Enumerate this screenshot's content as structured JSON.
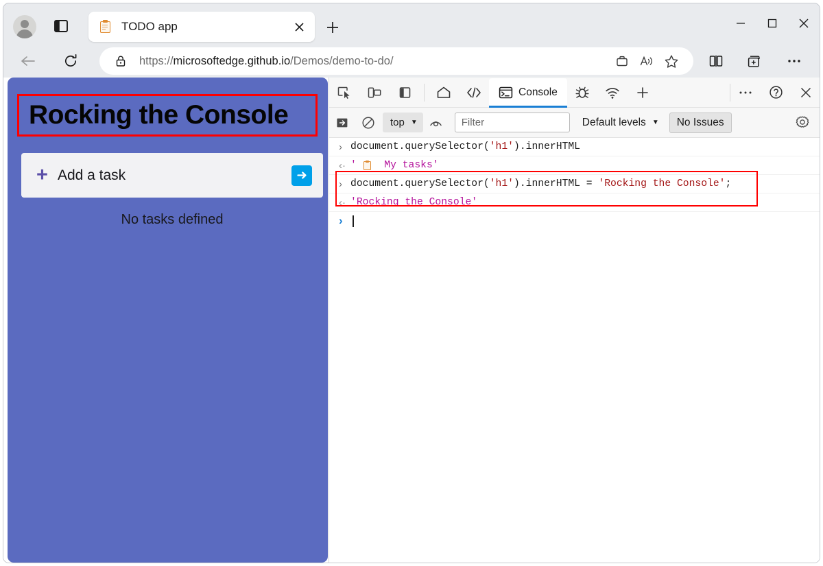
{
  "browser": {
    "tab": {
      "title": "TODO app",
      "favicon_icon": "clipboard-icon",
      "close_icon": "close-icon"
    },
    "new_tab_icon": "plus-icon",
    "profile_icon": "profile-avatar-icon",
    "tab_search_icon": "tab-search-icon",
    "nav": {
      "back_icon": "arrow-left-icon",
      "reload_icon": "reload-icon"
    },
    "omnibox": {
      "lock_icon": "lock-icon",
      "url_scheme": "https://",
      "url_host": "microsoftedge.github.io",
      "url_path": "/Demos/demo-to-do/",
      "url_full": "https://microsoftedge.github.io/Demos/demo-to-do/",
      "icons": [
        "shopping-bag-icon",
        "read-aloud-icon",
        "favorite-star-icon"
      ]
    },
    "chrome_icons": [
      "split-screen-icon",
      "collections-icon",
      "settings-more-icon"
    ],
    "window_controls": {
      "minimize": "minimize-icon",
      "maximize": "maximize-icon",
      "close": "close-icon"
    }
  },
  "page": {
    "heading": "Rocking the Console",
    "add_task_placeholder": "Add a task",
    "add_icon": "plus-icon",
    "submit_icon": "arrow-right-icon",
    "empty_message": "No tasks defined",
    "background_color": "#5b6bc0",
    "submit_button_color": "#00a0e9",
    "highlight_color": "#ff0000"
  },
  "devtools": {
    "toolbar_icons": [
      "inspect-element-icon",
      "device-emulation-icon",
      "dock-side-icon",
      "welcome-home-icon",
      "elements-icon"
    ],
    "active_tab": {
      "label": "Console",
      "icon": "console-icon"
    },
    "extra_tabs": [
      "debugger-icon",
      "network-icon",
      "add-panel-icon"
    ],
    "right_icons": [
      "more-tools-icon",
      "help-icon",
      "close-devtools-icon"
    ],
    "accent_color": "#1a7fd4",
    "console_toolbar": {
      "clear_console_icon": "clear-console-icon",
      "no-entry_icon": "no-entry-icon",
      "context_label": "top",
      "context_caret": "▼",
      "live_expression_icon": "eye-icon",
      "filter_placeholder": "Filter",
      "filter_value": "",
      "levels_label": "Default levels",
      "levels_caret": "▼",
      "issues_label": "No Issues",
      "settings_icon": "gear-icon"
    },
    "console_log": [
      {
        "type": "input",
        "arrow": "›",
        "tokens": [
          {
            "text": "document.querySelector(",
            "style": "plain"
          },
          {
            "text": "'h1'",
            "style": "str-input"
          },
          {
            "text": ").innerHTML",
            "style": "plain"
          }
        ],
        "highlighted": false
      },
      {
        "type": "result",
        "arrow": "‹·",
        "tokens": [
          {
            "text": "' ",
            "style": "str-result"
          },
          {
            "text": "[clipboard-icon]",
            "style": "favicon"
          },
          {
            "text": "  My tasks'",
            "style": "str-result"
          }
        ],
        "highlighted": false
      },
      {
        "type": "input",
        "arrow": "›",
        "tokens": [
          {
            "text": "document.querySelector(",
            "style": "plain"
          },
          {
            "text": "'h1'",
            "style": "str-input"
          },
          {
            "text": ").innerHTML = ",
            "style": "plain"
          },
          {
            "text": "'Rocking the Console'",
            "style": "str-input"
          },
          {
            "text": ";",
            "style": "plain"
          }
        ],
        "highlighted": true
      },
      {
        "type": "result",
        "arrow": "‹·",
        "tokens": [
          {
            "text": "'Rocking the Console'",
            "style": "str-result"
          }
        ],
        "highlighted": true
      },
      {
        "type": "prompt",
        "arrow": "›",
        "tokens": [],
        "highlighted": false
      }
    ],
    "string_color_input": "#a31515",
    "string_color_result": "#b4129b"
  }
}
